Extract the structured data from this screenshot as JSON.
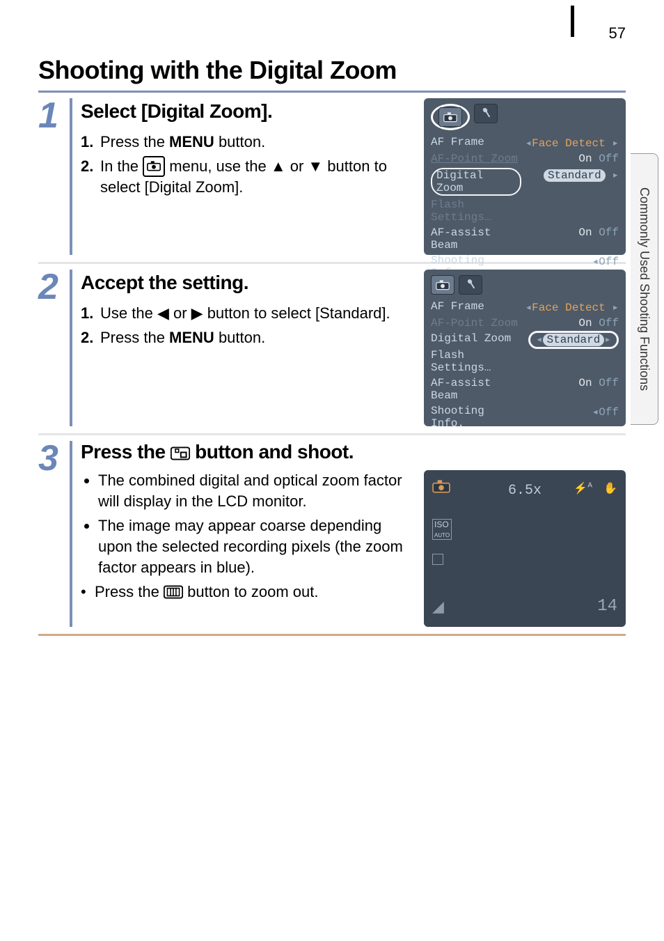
{
  "page_number": "57",
  "side_tab": "Commonly Used Shooting Functions",
  "title": "Shooting with the Digital Zoom",
  "steps": [
    {
      "num": "1",
      "heading": "Select [Digital Zoom].",
      "items": [
        {
          "num": "1",
          "pre": "Press the ",
          "bold": "MENU",
          "post": " button."
        },
        {
          "num": "2",
          "pre": "In the ",
          "icon": "camera-box",
          "mid": " menu, use the ",
          "tri1": "▲",
          "or": " or ",
          "tri2": "▼",
          "post2": " button to select [Digital Zoom]."
        }
      ],
      "lcd": {
        "highlight_row": 2,
        "circle_tab": true,
        "rows": [
          {
            "label": "AF Frame",
            "value_left": "◂",
            "value": "Face Detect",
            "value_right": "▸",
            "orange": true
          },
          {
            "label": "AF-Point Zoom",
            "value_on": "On",
            "value": " Off",
            "dim_label": true
          },
          {
            "label": "Digital Zoom",
            "value": "Standard",
            "pill_label": true,
            "pill_value": true,
            "arrow_right": true
          },
          {
            "label": "Flash Settings…",
            "value": "",
            "dim_label": true
          },
          {
            "label": "AF-assist Beam",
            "value_on": "On",
            "value": " Off"
          },
          {
            "label": "Shooting Info.",
            "value_left": "◂",
            "value": "Off"
          }
        ]
      }
    },
    {
      "num": "2",
      "heading": "Accept the setting.",
      "items": [
        {
          "num": "1",
          "pre": "Use the ",
          "tri1": "◀",
          "or": " or ",
          "tri2": "▶",
          "post2": " button to select [Standard]."
        },
        {
          "num": "2",
          "pre": "Press the ",
          "bold": "MENU",
          "post": " button."
        }
      ],
      "lcd": {
        "highlight_row": 2,
        "circle_tab": false,
        "rows": [
          {
            "label": "AF Frame",
            "value_left": "◂",
            "value": "Face Detect",
            "value_right": "▸",
            "orange": true
          },
          {
            "label": "AF-Point Zoom",
            "value_on": "On",
            "value": " Off",
            "dim_label": true
          },
          {
            "label": "Digital Zoom",
            "value_left": "◂",
            "value": "Standard",
            "value_right": "▸",
            "pill_value_wide": true
          },
          {
            "label": "Flash Settings…",
            "value": ""
          },
          {
            "label": "AF-assist Beam",
            "value_on": "On",
            "value": " Off"
          },
          {
            "label": "Shooting Info.",
            "value_left": "◂",
            "value": "Off"
          }
        ]
      }
    },
    {
      "num": "3",
      "heading_pre": "Press the ",
      "heading_icon": "zoom-in",
      "heading_post": " button and shoot.",
      "bullets": [
        "The combined digital and optical zoom factor will display in the LCD monitor.",
        "The image may appear coarse depending upon the selected recording pixels (the zoom factor appears in blue).."
      ],
      "bullets_fix": [
        "The combined digital and optical zoom factor will display in the LCD monitor.",
        "The image may appear coarse depending upon the selected recording pixels (the zoom factor appears in blue)."
      ],
      "last_line_pre": "Press the ",
      "last_line_icon": "zoom-out",
      "last_line_post": " button to zoom out.",
      "shoot": {
        "zoom": "6.5x",
        "shots": "14",
        "iso": "ISO\nAUTO"
      }
    }
  ]
}
